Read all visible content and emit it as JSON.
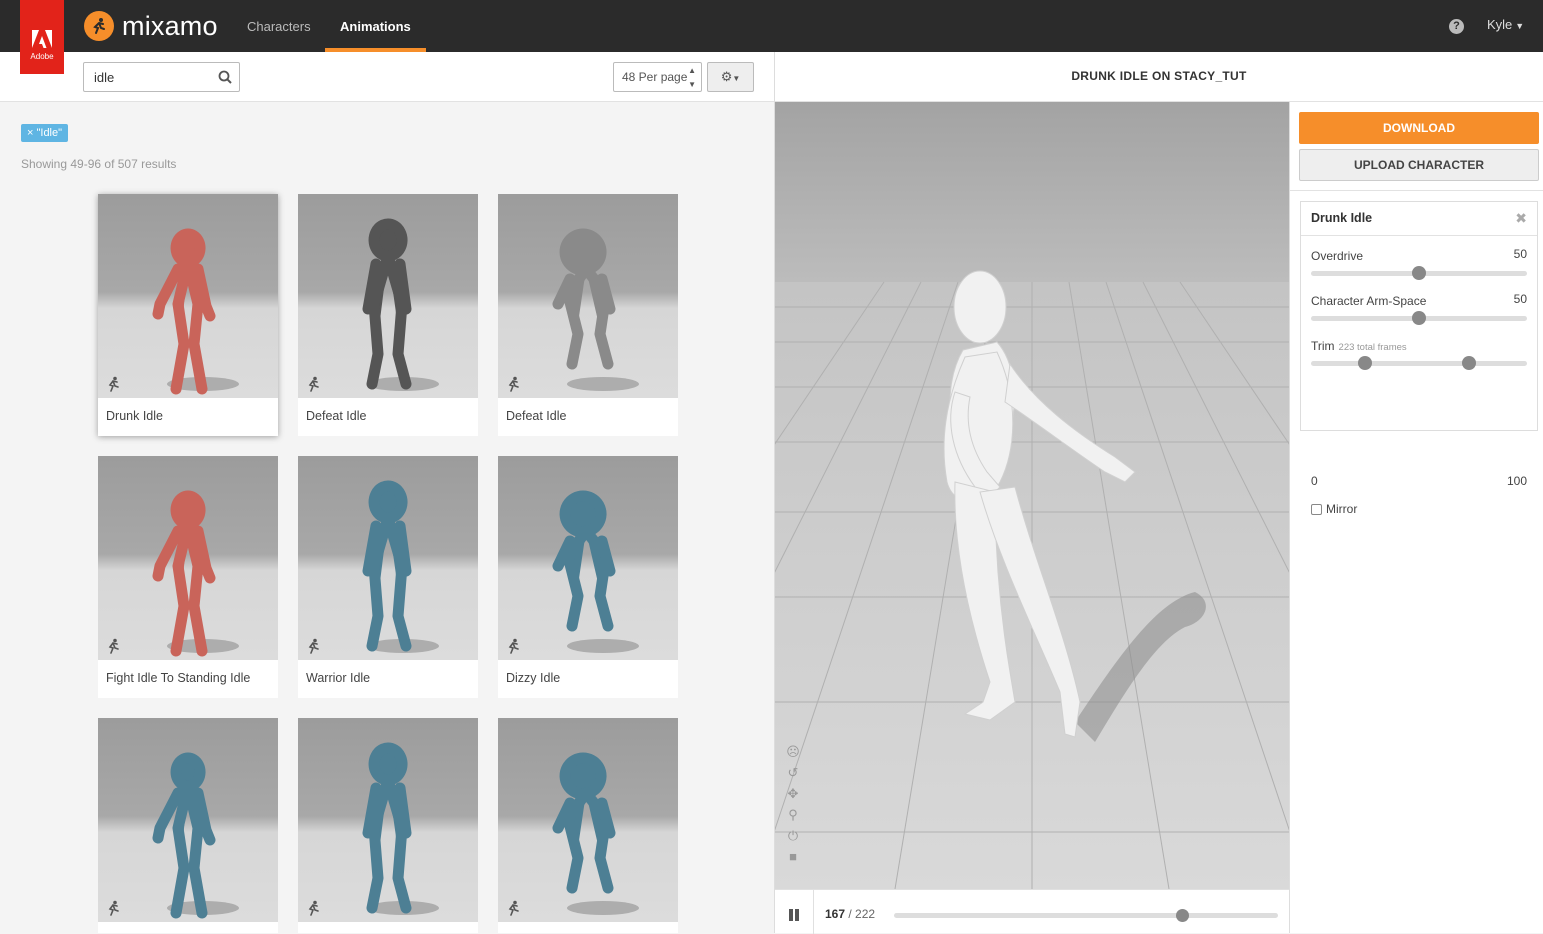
{
  "nav": {
    "adobe_label": "Adobe",
    "brand": "mixamo",
    "tabs": [
      {
        "label": "Characters",
        "active": false
      },
      {
        "label": "Animations",
        "active": true
      }
    ],
    "help_icon": "?",
    "user": "Kyle"
  },
  "search": {
    "value": "idle",
    "per_page": "48 Per page"
  },
  "filter_tag": "× \"Idle\"",
  "results_text": "Showing 49-96 of 507 results",
  "cards": [
    {
      "label": "Drunk Idle",
      "color": "#c9645a",
      "selected": true
    },
    {
      "label": "Defeat Idle",
      "color": "#555555",
      "selected": false
    },
    {
      "label": "Defeat Idle",
      "color": "#8a8a8a",
      "selected": false
    },
    {
      "label": "Fight Idle To Standing Idle",
      "color": "#c9645a",
      "selected": false
    },
    {
      "label": "Warrior Idle",
      "color": "#4d7f94",
      "selected": false
    },
    {
      "label": "Dizzy Idle",
      "color": "#4d7f94",
      "selected": false
    },
    {
      "label": "",
      "color": "#4d7f94",
      "selected": false
    },
    {
      "label": "",
      "color": "#4d7f94",
      "selected": false
    },
    {
      "label": "",
      "color": "#4d7f94",
      "selected": false
    }
  ],
  "viewer": {
    "title": "DRUNK IDLE ON STACY_TUT",
    "frame_current": "167",
    "frame_total": "/ 222",
    "playhead_fraction": 0.75
  },
  "panel": {
    "download": "DOWNLOAD",
    "upload": "UPLOAD CHARACTER",
    "anim_name": "Drunk Idle",
    "sliders": [
      {
        "label": "Overdrive",
        "value": "50",
        "fraction": 0.5
      },
      {
        "label": "Character Arm-Space",
        "value": "50",
        "fraction": 0.5
      }
    ],
    "trim": {
      "label": "Trim",
      "note": "223 total frames",
      "min": "0",
      "max": "100",
      "low_fraction": 0.25,
      "high_fraction": 0.73
    },
    "mirror": "Mirror"
  },
  "colors": {
    "accent": "#f68e2a",
    "tag": "#5fb5e3",
    "adobe": "#e2231a"
  }
}
